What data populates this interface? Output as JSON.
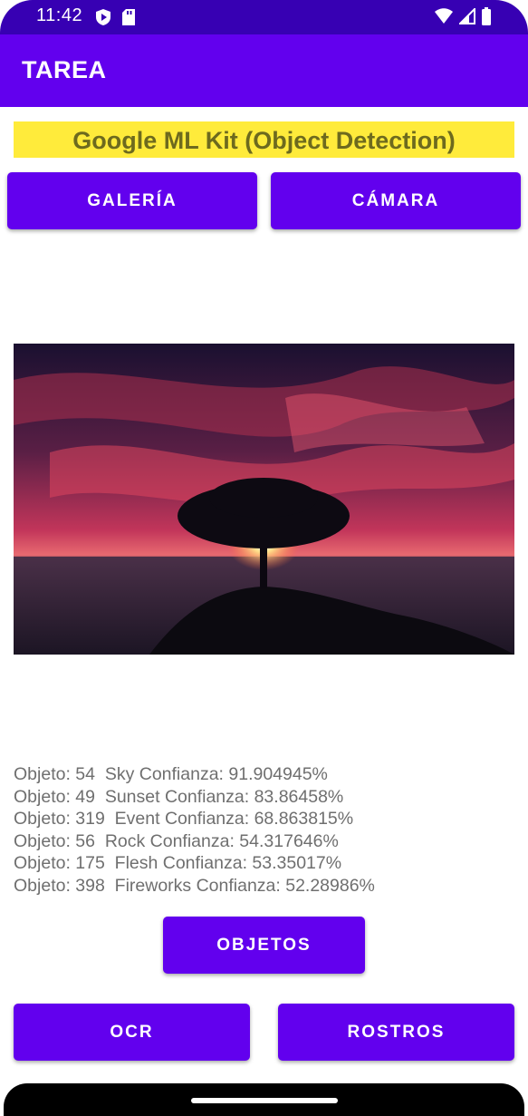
{
  "status_bar": {
    "time": "11:42",
    "icons_left": [
      "shield-play-icon",
      "sd-card-icon"
    ],
    "icons_right": [
      "wifi-icon",
      "cell-signal-icon",
      "battery-icon"
    ]
  },
  "app_bar": {
    "title": "TAREA"
  },
  "heading": {
    "text": "Google ML Kit (Object Detection)"
  },
  "buttons": {
    "gallery": "GALERÍA",
    "camera": "CÁMARA",
    "objects": "OBJETOS",
    "ocr": "OCR",
    "faces": "ROSTROS"
  },
  "image": {
    "description_icon": "sunset-tree-photo"
  },
  "results": [
    "Objeto: 54  Sky Confianza: 91.904945%",
    "Objeto: 49  Sunset Confianza: 83.86458%",
    "Objeto: 319  Event Confianza: 68.863815%",
    "Objeto: 56  Rock Confianza: 54.317646%",
    "Objeto: 175  Flesh Confianza: 53.35017%",
    "Objeto: 398  Fireworks Confianza: 52.28986%"
  ],
  "colors": {
    "primary": "#6200ee",
    "primary_dark": "#3700b3",
    "heading_bg": "#ffeb3b",
    "heading_text": "#6d6a1e"
  }
}
